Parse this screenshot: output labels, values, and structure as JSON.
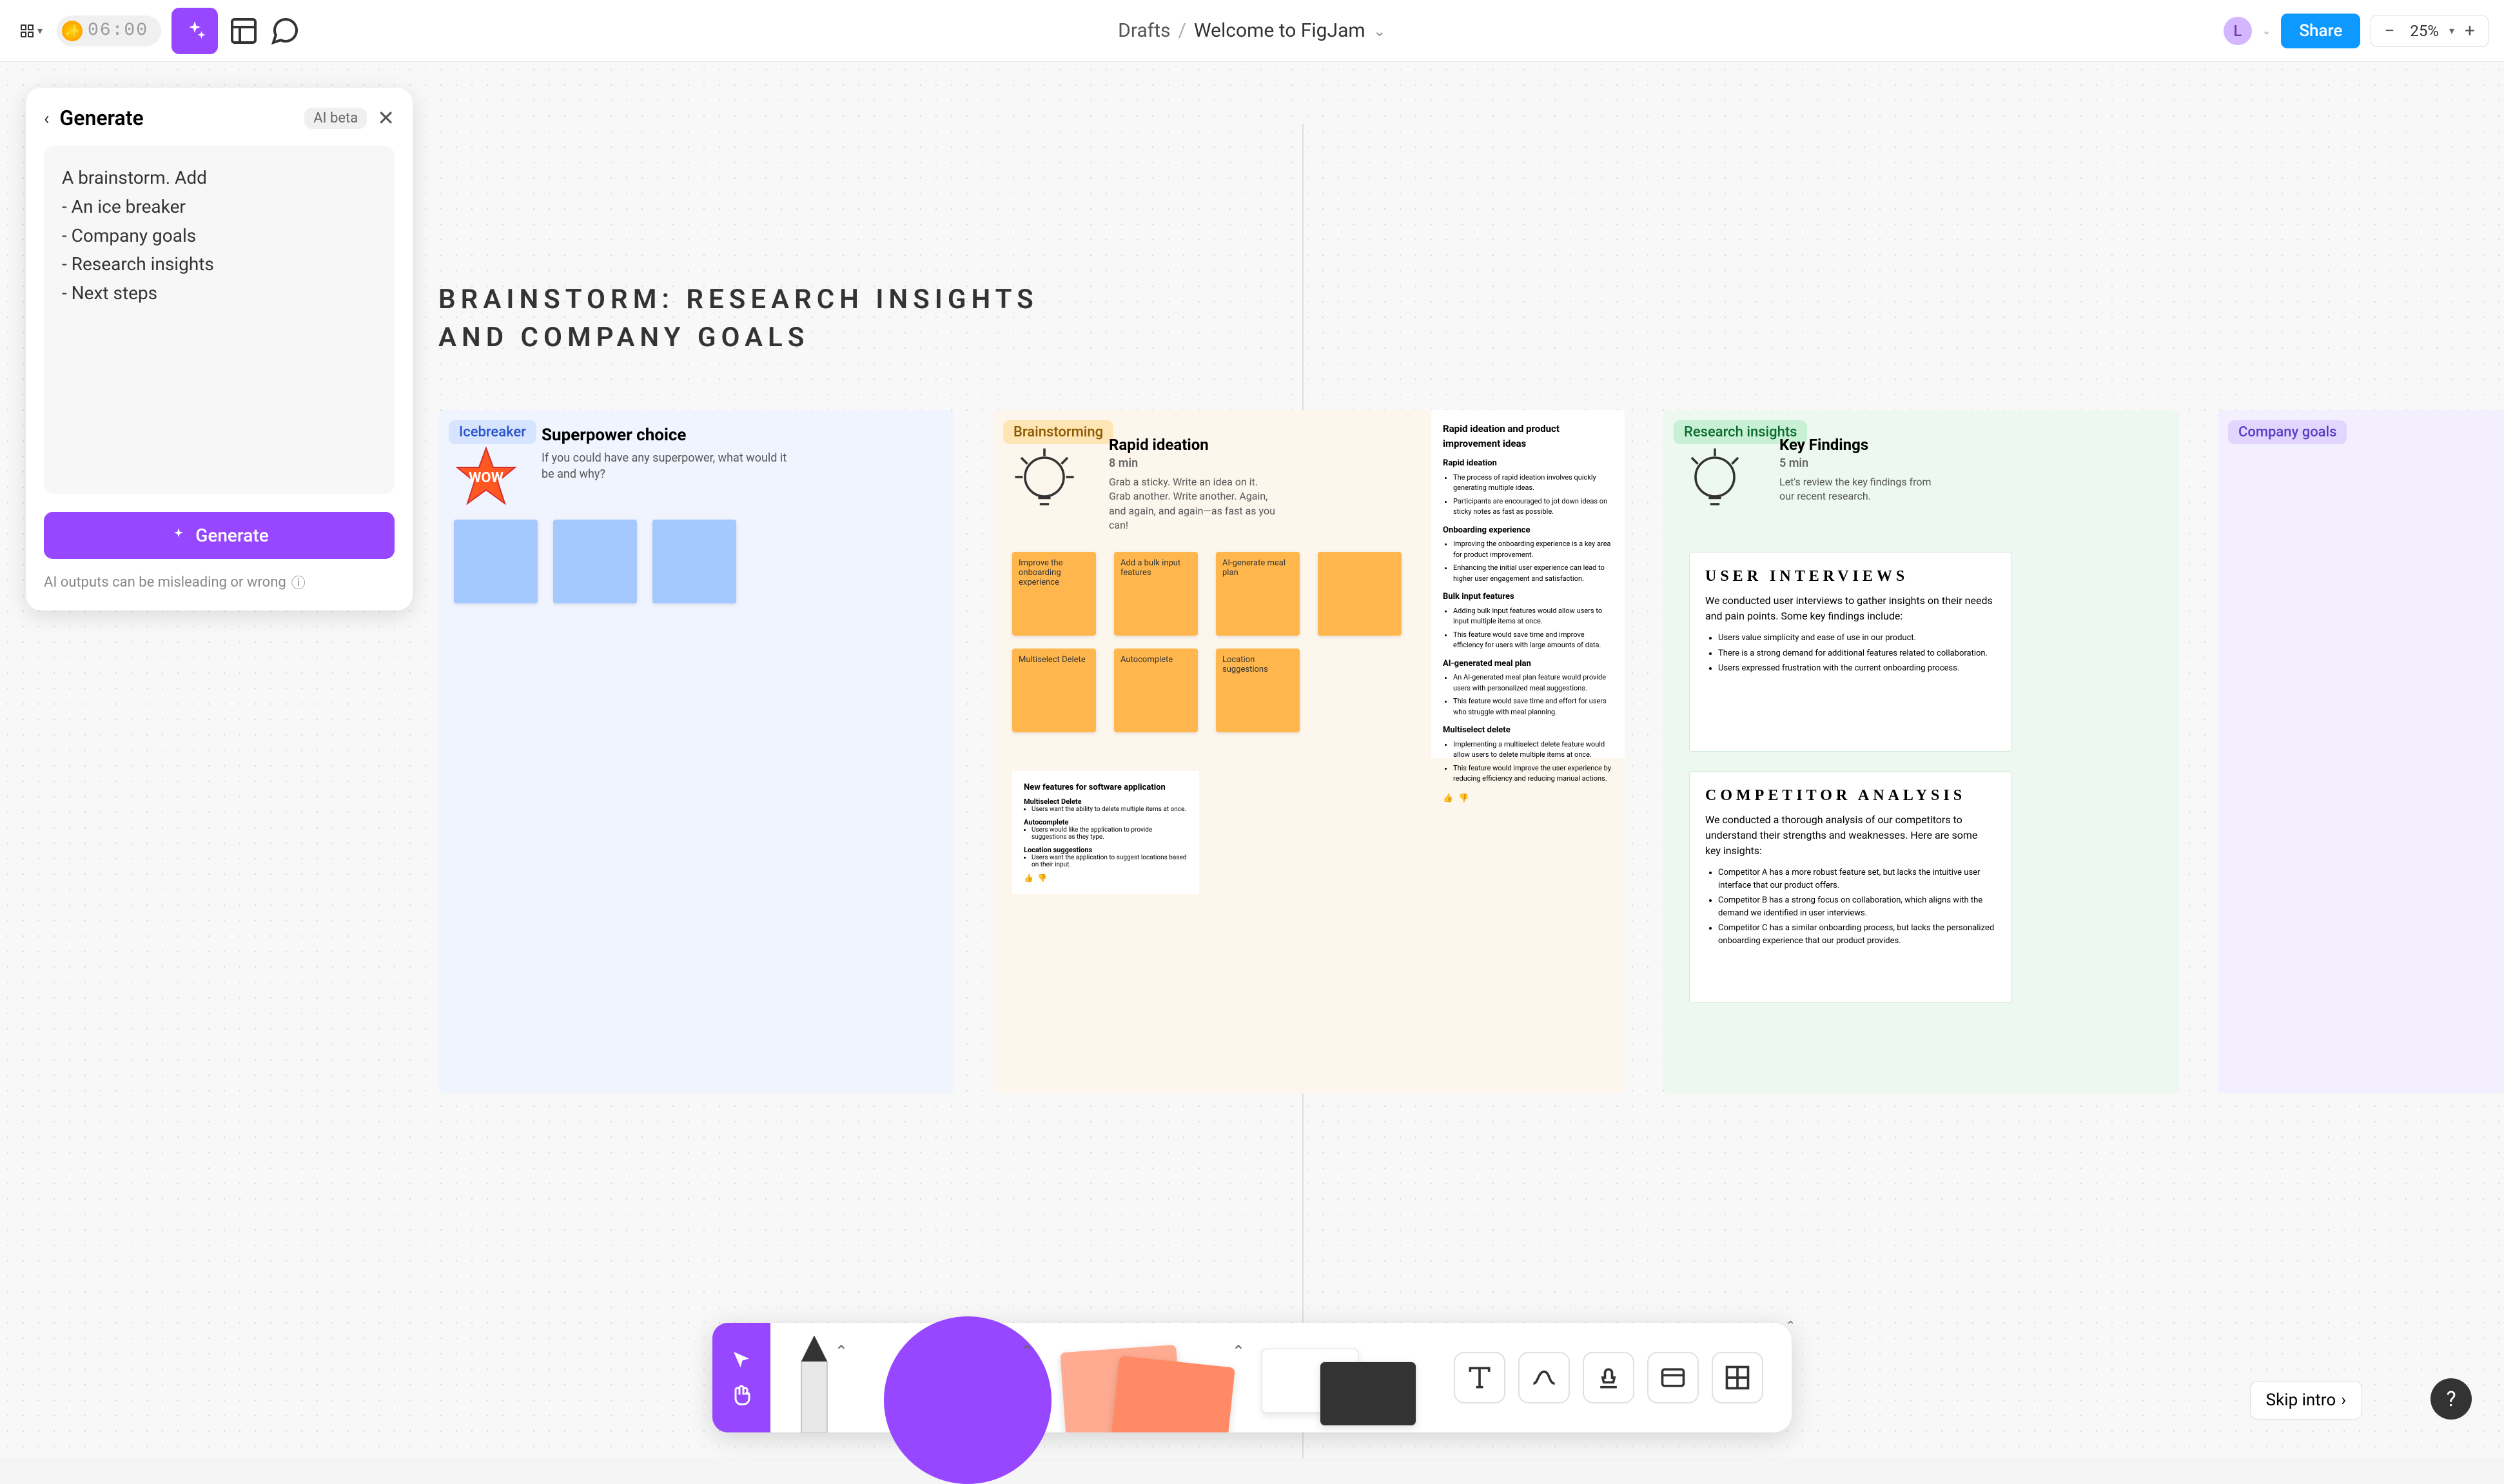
{
  "topbar": {
    "timer": "06:00",
    "breadcrumb_root": "Drafts",
    "doc_title": "Welcome to FigJam",
    "avatar_initial": "L",
    "share_label": "Share",
    "zoom": "25%"
  },
  "ai_panel": {
    "title": "Generate",
    "badge": "AI beta",
    "prompt": "A brainstorm. Add\n- An ice breaker\n- Company goals\n- Research insights\n- Next steps",
    "generate_label": "Generate",
    "disclaimer": "AI outputs can be misleading or wrong"
  },
  "canvas": {
    "title_line1": "Brainstorm: Research Insights",
    "title_line2": "and Company Goals",
    "icebreaker": {
      "tag": "Icebreaker",
      "heading": "Superpower choice",
      "sub": "If you could have any superpower, what would it be and why?"
    },
    "brainstorming": {
      "tag": "Brainstorming",
      "heading": "Rapid ideation",
      "duration": "8 min",
      "sub": "Grab a sticky. Write an idea on it. Grab another. Write another. Again, and again, and again—as fast as you can!",
      "stickies": [
        "Improve the onboarding experience",
        "Add a bulk input features",
        "AI-generate meal plan",
        "",
        "Multiselect Delete",
        "Autocomplete",
        "Location suggestions"
      ],
      "sidebar": {
        "title": "Rapid ideation and product improvement ideas",
        "groups": [
          {
            "h": "Rapid ideation",
            "items": [
              "The process of rapid ideation involves quickly generating multiple ideas.",
              "Participants are encouraged to jot down ideas on sticky notes as fast as possible."
            ]
          },
          {
            "h": "Onboarding experience",
            "items": [
              "Improving the onboarding experience is a key area for product improvement.",
              "Enhancing the initial user experience can lead to higher user engagement and satisfaction."
            ]
          },
          {
            "h": "Bulk input features",
            "items": [
              "Adding bulk input features would allow users to input multiple items at once.",
              "This feature would save time and improve efficiency for users with large amounts of data."
            ]
          },
          {
            "h": "AI-generated meal plan",
            "items": [
              "An AI-generated meal plan feature would provide users with personalized meal suggestions.",
              "This feature would save time and effort for users who struggle with meal planning."
            ]
          },
          {
            "h": "Multiselect delete",
            "items": [
              "Implementing a multiselect delete feature would allow users to delete multiple items at once.",
              "This feature would improve the user experience by reducing efficiency and reducing manual actions."
            ]
          }
        ]
      },
      "doc": {
        "title": "New features for software application",
        "sections": [
          {
            "h": "Multiselect Delete",
            "body": "Users want the ability to delete multiple items at once."
          },
          {
            "h": "Autocomplete",
            "body": "Users would like the application to provide suggestions as they type."
          },
          {
            "h": "Location suggestions",
            "body": "Users want the application to suggest locations based on their input."
          }
        ]
      }
    },
    "research": {
      "tag": "Research insights",
      "heading": "Key Findings",
      "duration": "5 min",
      "sub": "Let's review the key findings from our recent research.",
      "card1": {
        "title": "User Interviews",
        "body": "We conducted user interviews to gather insights on their needs and pain points. Some key findings include:",
        "bullets": [
          "Users value simplicity and ease of use in our product.",
          "There is a strong demand for additional features related to collaboration.",
          "Users expressed frustration with the current onboarding process."
        ]
      },
      "card2": {
        "title": "Competitor Analysis",
        "body": "We conducted a thorough analysis of our competitors to understand their strengths and weaknesses. Here are some key insights:",
        "bullets": [
          "Competitor A has a more robust feature set, but lacks the intuitive user interface that our product offers.",
          "Competitor B has a strong focus on collaboration, which aligns with the demand we identified in user interviews.",
          "Competitor C has a similar onboarding process, but lacks the personalized onboarding experience that our product provides."
        ]
      }
    },
    "goals": {
      "tag": "Company goals"
    }
  },
  "footer": {
    "skip_label": "Skip intro"
  }
}
